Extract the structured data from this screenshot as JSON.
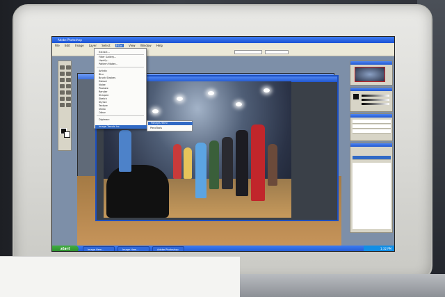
{
  "window": {
    "title": "Adobe Photoshop"
  },
  "menubar": {
    "items": [
      "File",
      "Edit",
      "Image",
      "Layer",
      "Select",
      "Filter",
      "View",
      "Window",
      "Help"
    ],
    "active_index": 5
  },
  "filter_menu": {
    "items": [
      "Extract...",
      "Filter Gallery...",
      "Liquify...",
      "Pattern Maker...",
      "Artistic",
      "Blur",
      "Brush Strokes",
      "Distort",
      "Noise",
      "Pixelate",
      "Render",
      "Sharpen",
      "Sketch",
      "Stylize",
      "Texture",
      "Video",
      "Other",
      "Digimarc"
    ],
    "highlighted": "Image Trends Inc"
  },
  "submenu": {
    "items": [
      "Fisheye-Hemi",
      "PanoTools"
    ]
  },
  "taskbar": {
    "start_label": "start",
    "tasks": [
      "Image Hem...",
      "Image Hem...",
      "Adobe Photoshop"
    ],
    "clock": "1:32 PM"
  },
  "colors": {
    "title_blue": "#2157cf",
    "taskbar_blue": "#1f55cf",
    "start_green": "#2a8a2a",
    "menu_highlight": "#316ac5",
    "bezel": "#d7d7d3"
  }
}
